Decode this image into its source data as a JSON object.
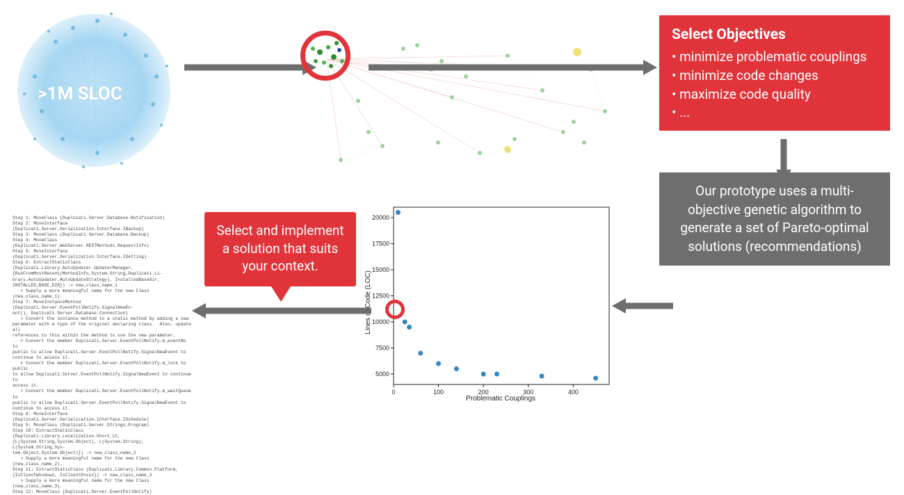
{
  "sloc_badge": ">1M SLOC",
  "objectives": {
    "title": "Select Objectives",
    "items": [
      "minimize problematic couplings",
      "minimize code changes",
      "maximize code quality",
      "..."
    ]
  },
  "algorithm_note": "Our prototype uses a multi-objective genetic algorithm to generate a set of Pareto-optimal solutions (recommendations)",
  "callout_text": "Select and implement a solution that suits your context.",
  "steps_text": "Step 1: MoveClass (Duplicati.Server.Database.Notification)\nStep 2: MoveInterface (Duplicati.Server.Serialization.Interface.IBackup)\nStep 3: MoveClass (Duplicati.Server.Database.Backup)\nStep 4: MoveClass (Duplicati.Server.WebServer.RESTMethods.RequestInfo)\nStep 5: MoveInterface (Duplicati.Server.Serialization.Interface.ISetting)\nStep 6: ExtractStaticClass (Duplicati.Library.AutoUpdater.UpdaterManager,\n{RunFromMostRecent(MethodInfo,System.String,Duplicati.Li-\nbrary.AutoUpdater.AutoUpdateStrategy), InstalledBaseDir,\nINSTALLED_BASE_DIR}) -> new_class_name_1\n   > Supply a more meaningful name for the new Class (new_class_name_1).\nStep 7: MoveInstanceMethod (Duplicati.Server.EventPollNotify.SignalNewEv-\nent(), Duplicati.Server.Database.Connection)\n   > Convert the instance method to a static method by adding a new\nparameter with a type of the original declaring class.  Also, update all\nreferences to this within the method to use the new parameter.\n   > Convert the member Duplicati.Server.EventPollNotify.m_eventNo to\npublic to allow Duplicati.Server.EventPollNotify.SignalNewEvent to\ncontinue to access it.\n   > Convert the member Duplicati.Server.EventPollNotify.m_lock to public\nto allow Duplicati.Server.EventPollNotify.SignalNewEvent to continue to\naccess it.\n   > Convert the member Duplicati.Server.EventPollNotify.m_waitQueue to\npublic to allow Duplicati.Server.EventPollNotify.SignalNewEvent to\ncontinue to access it.\nStep 8: MoveInterface (Duplicati.Server.Serialization.Interface.ISchedule)\nStep 9: MoveClass (Duplicati.Server.Strings.Program)\nStep 10: ExtractStaticClass (Duplicati.Library.Localization.Short.LC,\n{L(System.String,System.Object), L(System.String), L(System.String,Sys-\ntem.Object,System.Object)}) -> new_class_name_2\n   > Supply a more meaningful name for the new Class (new_class_name_2).\nStep 11: ExtractStaticClass (Duplicati.Library.Common.Platform,\n{IsClientWindows, IsClientPosix}) -> new_class_name_3\n   > Supply a more meaningful name for the new Class (new_class_name_3).\nStep 12: MoveClass (Duplicati.Server.EventPollNotify)",
  "chart_data": {
    "type": "scatter",
    "title": "",
    "xlabel": "Problematic Couplings",
    "ylabel": "Lines of Code (LOC)",
    "xlim": [
      0,
      480
    ],
    "ylim": [
      4000,
      21000
    ],
    "xticks": [
      0,
      100,
      200,
      300,
      400
    ],
    "yticks": [
      5000,
      7500,
      10000,
      12500,
      15000,
      17500,
      20000
    ],
    "points": [
      {
        "x": 10,
        "y": 20500
      },
      {
        "x": 25,
        "y": 10000
      },
      {
        "x": 35,
        "y": 9500
      },
      {
        "x": 60,
        "y": 7000
      },
      {
        "x": 100,
        "y": 6000
      },
      {
        "x": 140,
        "y": 5500
      },
      {
        "x": 200,
        "y": 5000
      },
      {
        "x": 230,
        "y": 5000
      },
      {
        "x": 330,
        "y": 4800
      },
      {
        "x": 450,
        "y": 4600
      }
    ],
    "highlight_index": 1
  }
}
